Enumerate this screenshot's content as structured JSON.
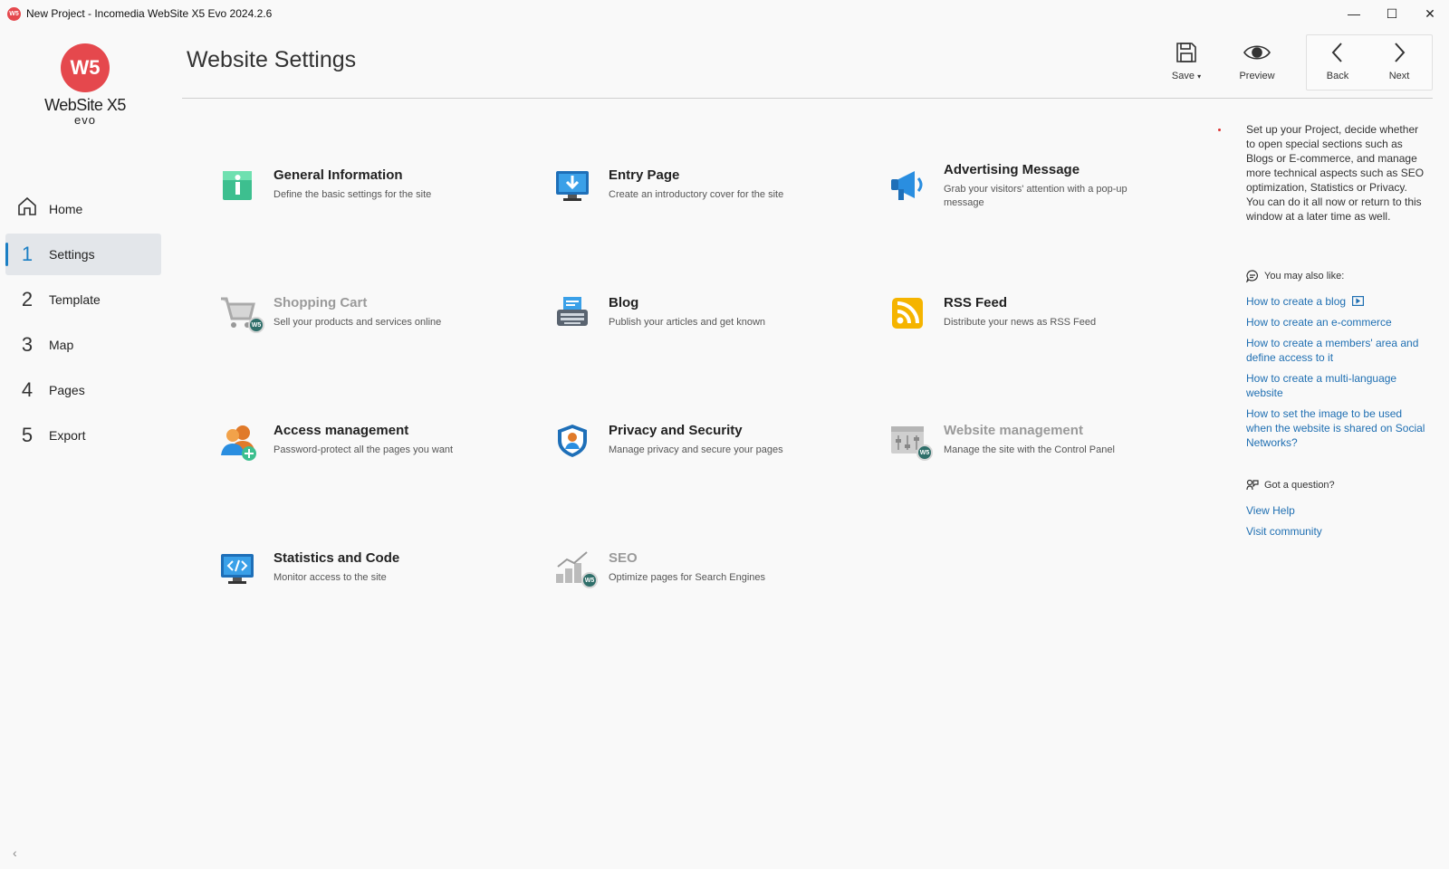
{
  "window": {
    "title": "New Project - Incomedia WebSite X5 Evo 2024.2.6",
    "app_icon_text": "W5",
    "minimize": "—",
    "maximize": "☐",
    "close": "✕"
  },
  "logo": {
    "mark": "W5",
    "name": "WebSite X5",
    "edition": "evo"
  },
  "nav": {
    "home": {
      "label": "Home",
      "icon": "home-icon"
    },
    "items": [
      {
        "num": "1",
        "label": "Settings",
        "active": true
      },
      {
        "num": "2",
        "label": "Template"
      },
      {
        "num": "3",
        "label": "Map"
      },
      {
        "num": "4",
        "label": "Pages"
      },
      {
        "num": "5",
        "label": "Export"
      }
    ],
    "collapse": "‹"
  },
  "header": {
    "title": "Website Settings",
    "save_label": "Save",
    "save_caret": "▾",
    "preview_label": "Preview",
    "back_label": "Back",
    "next_label": "Next"
  },
  "cards": [
    {
      "title": "General Information",
      "desc": "Define the basic settings for the site",
      "icon": "info-icon"
    },
    {
      "title": "Entry Page",
      "desc": "Create an introductory cover for the site",
      "icon": "monitor-download-icon"
    },
    {
      "title": "Advertising Message",
      "desc": "Grab your visitors' attention with a pop-up message",
      "icon": "megaphone-icon"
    },
    {
      "title": "Shopping Cart",
      "desc": "Sell your products and services online",
      "icon": "shopping-cart-icon",
      "disabled": true,
      "badge": "W5"
    },
    {
      "title": "Blog",
      "desc": "Publish your articles and get known",
      "icon": "typewriter-icon"
    },
    {
      "title": "RSS Feed",
      "desc": "Distribute your news as RSS Feed",
      "icon": "rss-icon"
    },
    {
      "title": "Access management",
      "desc": "Password-protect all the pages you want",
      "icon": "users-add-icon"
    },
    {
      "title": "Privacy and Security",
      "desc": "Manage privacy and secure your pages",
      "icon": "shield-user-icon"
    },
    {
      "title": "Website management",
      "desc": "Manage the site with the Control Panel",
      "icon": "control-panel-icon",
      "disabled": true,
      "badge": "W5"
    },
    {
      "title": "Statistics and Code",
      "desc": "Monitor access to the site",
      "icon": "code-monitor-icon"
    },
    {
      "title": "SEO",
      "desc": "Optimize pages for Search Engines",
      "icon": "seo-chart-icon",
      "disabled": true,
      "badge": "W5"
    }
  ],
  "panel": {
    "intro": "Set up your Project, decide whether to open special sections such as Blogs or E-commerce, and manage more technical aspects such as SEO optimization, Statistics or Privacy. You can do it all now or return to this window at a later time as well.",
    "also_like_heading": "You may also like:",
    "links": [
      "How to create a blog",
      "How to create an e-commerce",
      "How to create a members' area and define access to it",
      "How to create a multi-language website",
      "How to set the image to be used when the website is shared  on Social Networks?"
    ],
    "question_heading": "Got a question?",
    "help_links": [
      "View Help",
      "Visit community"
    ]
  },
  "colors": {
    "accent": "#1b7fc4",
    "brand": "#e5484d",
    "link": "#1f6fb2",
    "disabled_text": "#9a9a9a"
  }
}
